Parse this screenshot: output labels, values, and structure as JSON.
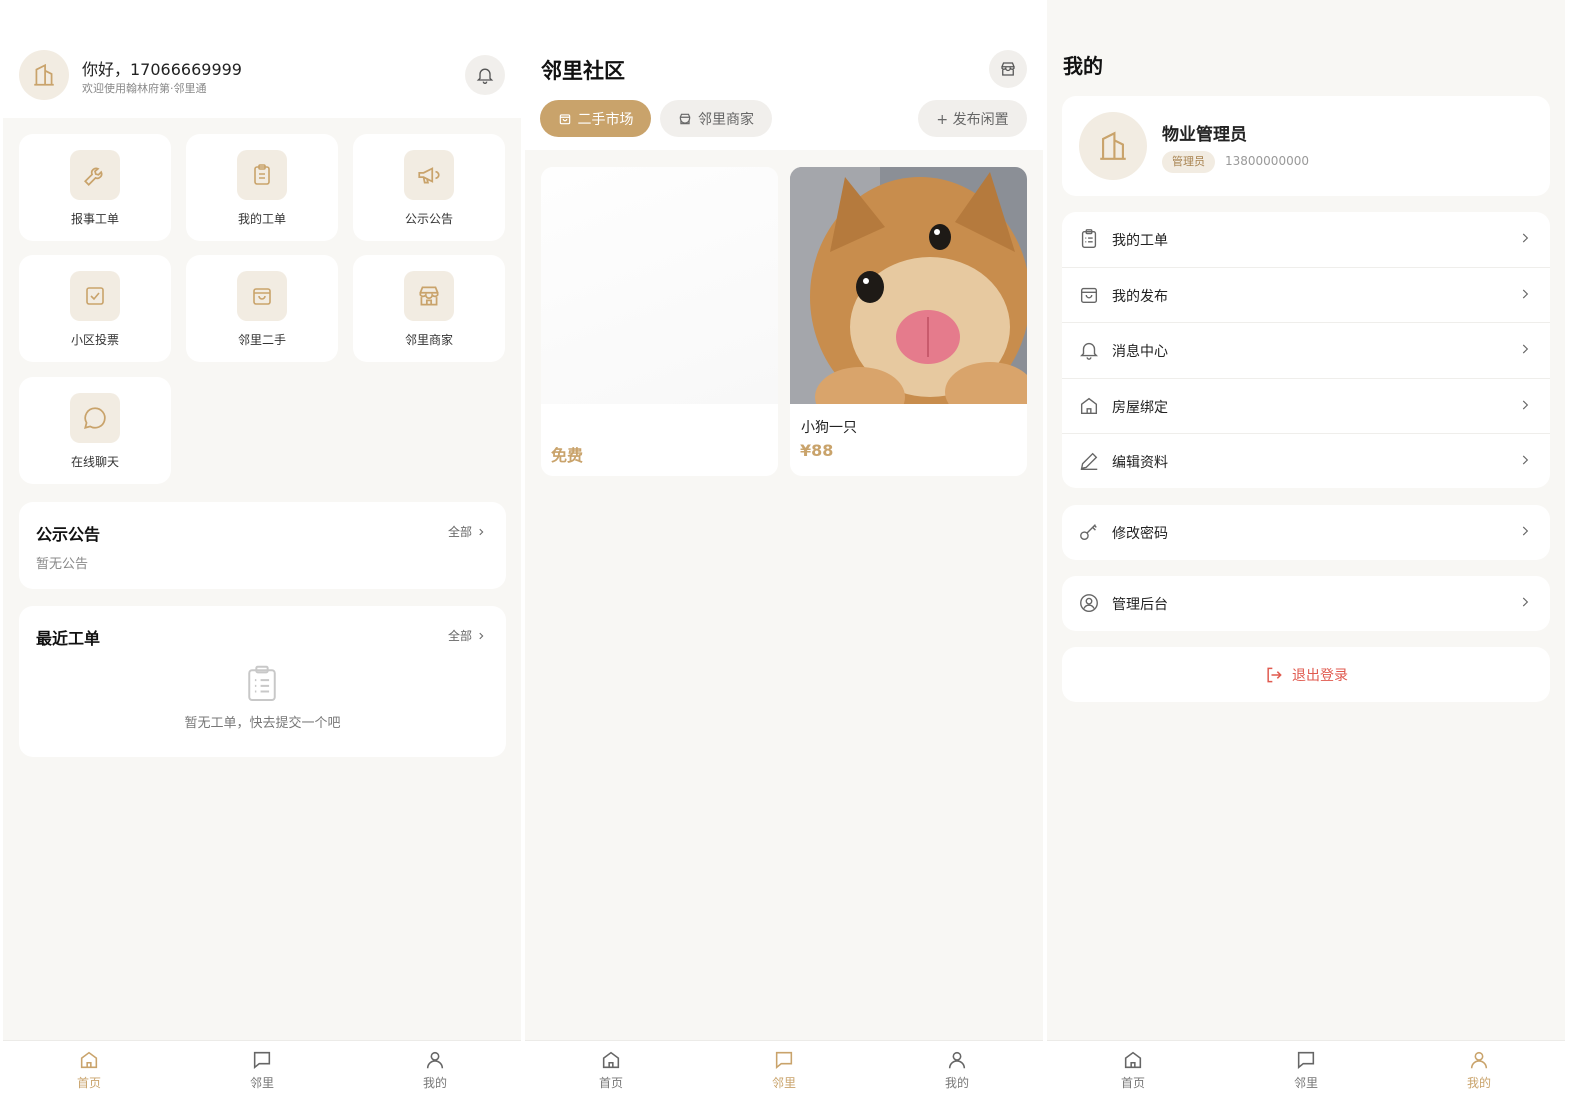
{
  "colors": {
    "accent": "#c9a36b",
    "accent_light": "#f2ece2",
    "danger": "#e05a4f",
    "background": "#f8f7f4"
  },
  "home": {
    "greeting": "你好，17066669999",
    "subtitle": "欢迎使用翰林府第·邻里通",
    "grid": [
      {
        "label": "报事工单",
        "icon": "wrench-icon"
      },
      {
        "label": "我的工单",
        "icon": "clipboard-icon"
      },
      {
        "label": "公示公告",
        "icon": "megaphone-icon"
      },
      {
        "label": "小区投票",
        "icon": "checkbox-icon"
      },
      {
        "label": "邻里二手",
        "icon": "shopping-bag-icon"
      },
      {
        "label": "邻里商家",
        "icon": "store-icon"
      },
      {
        "label": "在线聊天",
        "icon": "chat-bubble-icon"
      }
    ],
    "notice": {
      "title": "公示公告",
      "all": "全部",
      "empty": "暂无公告"
    },
    "orders": {
      "title": "最近工单",
      "all": "全部",
      "empty": "暂无工单，快去提交一个吧"
    }
  },
  "community": {
    "title": "邻里社区",
    "tabs": [
      {
        "label": "二手市场",
        "active": true
      },
      {
        "label": "邻里商家",
        "active": false
      }
    ],
    "publish_label": "+ 发布闲置",
    "items": [
      {
        "title": "",
        "price": "免费"
      },
      {
        "title": "小狗一只",
        "price": "¥88"
      }
    ]
  },
  "profile": {
    "title": "我的",
    "name": "物业管理员",
    "role": "管理员",
    "phone": "13800000000",
    "menu_group_1": [
      {
        "label": "我的工单",
        "icon": "clipboard-icon"
      },
      {
        "label": "我的发布",
        "icon": "shopping-bag-icon"
      },
      {
        "label": "消息中心",
        "icon": "bell-icon"
      },
      {
        "label": "房屋绑定",
        "icon": "home-icon"
      },
      {
        "label": "编辑资料",
        "icon": "pencil-icon"
      }
    ],
    "menu_group_2": [
      {
        "label": "修改密码",
        "icon": "key-icon"
      }
    ],
    "menu_group_3": [
      {
        "label": "管理后台",
        "icon": "user-circle-icon"
      }
    ],
    "logout": "退出登录"
  },
  "tabbar": [
    {
      "label": "首页",
      "icon": "home-icon"
    },
    {
      "label": "邻里",
      "icon": "chat-icon"
    },
    {
      "label": "我的",
      "icon": "user-icon"
    }
  ]
}
